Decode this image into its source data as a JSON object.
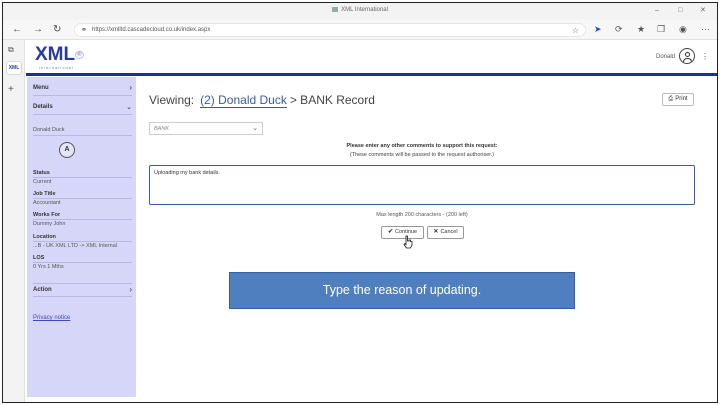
{
  "browser": {
    "window_title": "XML International",
    "url": "https://xmlltd.cascadecloud.co.uk/index.aspx",
    "vtab_label": "XML"
  },
  "header": {
    "logo_text": "XML",
    "logo_reg": "®",
    "logo_sub": "international",
    "username": "Donald"
  },
  "sidebar": {
    "menu_label": "Menu",
    "details_label": "Details",
    "person_name": "Donald Duck",
    "avatar_initial": "A",
    "fields": [
      {
        "label": "Status",
        "value": "Current"
      },
      {
        "label": "Job Title",
        "value": "Accountant"
      },
      {
        "label": "Works For",
        "value": "Dummy John"
      },
      {
        "label": "Location",
        "value": "...B - UK XML LTD -> XML Internal"
      },
      {
        "label": "LOS",
        "value": "0 Yrs 1 Mths"
      }
    ],
    "action_label": "Action",
    "privacy_label": "Privacy notice"
  },
  "main": {
    "viewing_prefix": "Viewing:",
    "viewing_link": "(2) Donald Duck",
    "viewing_rest": "> BANK Record",
    "print_label": "Print",
    "bank_select_value": "BANK",
    "prompt": "Please enter any other comments to support this request:",
    "prompt_sub": "(These comments will be passed to the request authoriser.)",
    "comment_value": "Uploading my bank details.",
    "maxlen_text": "Max length 200 characters - (200 left)",
    "continue_label": "Continue",
    "cancel_label": "Cancel"
  },
  "callout": {
    "text": "Type the reason of updating."
  },
  "colors": {
    "brand_blue": "#2a3a9c",
    "panel_lavender": "#d6d6f8",
    "callout_blue": "#4f7fbf"
  }
}
